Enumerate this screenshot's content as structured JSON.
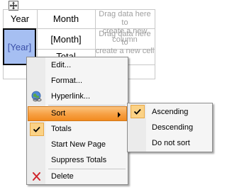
{
  "grid": {
    "header": {
      "year": "Year",
      "month": "Month",
      "drop_column_hint": [
        "Drag data here to",
        "create a new column"
      ]
    },
    "row1": {
      "year_field": "[Year]",
      "month_field": "[Month]",
      "drop_cell_hint": [
        "Drag data here to",
        "create a new cell"
      ]
    },
    "row2": {
      "total_partial": "Total"
    }
  },
  "context_menu": {
    "items": [
      {
        "label": "Edit...",
        "icon": "none"
      },
      {
        "label": "Format...",
        "icon": "none"
      },
      {
        "label": "Hyperlink...",
        "icon": "globe-link-icon"
      },
      {
        "label": "Sort",
        "icon": "none",
        "highlighted": true,
        "has_submenu": true
      },
      {
        "label": "Totals",
        "icon": "check-icon",
        "checked": true
      },
      {
        "label": "Start New Page",
        "icon": "none"
      },
      {
        "label": "Suppress Totals",
        "icon": "none"
      },
      {
        "label": "Delete",
        "icon": "red-x-icon"
      }
    ]
  },
  "sort_submenu": {
    "items": [
      {
        "label": "Ascending",
        "checked": true
      },
      {
        "label": "Descending",
        "checked": false
      },
      {
        "label": "Do not sort",
        "checked": false
      }
    ]
  },
  "colors": {
    "selected_cell_bg": "#a6bff2",
    "selected_cell_text": "#3a4fa8",
    "hint_text": "#a0a0a0",
    "menu_highlight": "#f7a247",
    "check_box_bg": "#fbd286"
  }
}
